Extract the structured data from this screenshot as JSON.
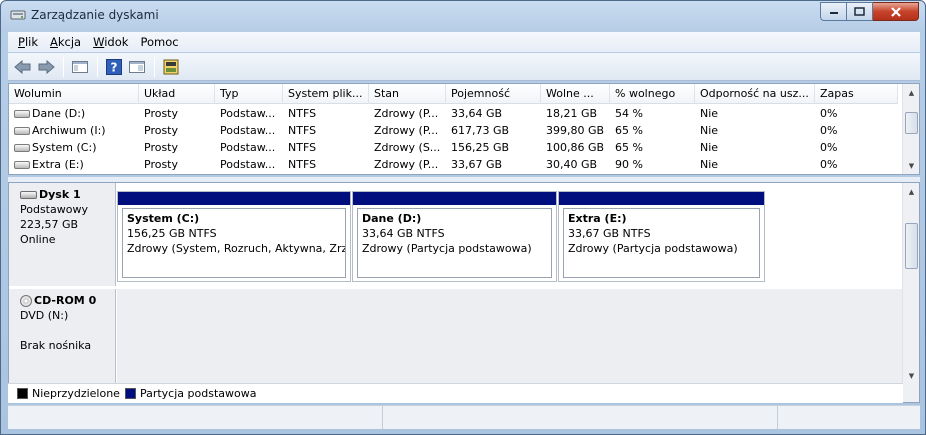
{
  "window": {
    "title": "Zarządzanie dyskami"
  },
  "menu": {
    "items": [
      {
        "label": "Plik",
        "accel": "P",
        "rest": "lik"
      },
      {
        "label": "Akcja",
        "accel": "A",
        "rest": "kcja"
      },
      {
        "label": "Widok",
        "accel": "W",
        "rest": "idok"
      },
      {
        "label": "Pomoc",
        "accel": "",
        "rest": "Pomoc"
      }
    ]
  },
  "toolbar": {
    "icons": [
      "back-icon",
      "forward-icon",
      "console-tree-icon",
      "help-icon",
      "properties-icon",
      "disk-settings-icon"
    ]
  },
  "volume_table": {
    "columns": [
      "Wolumin",
      "Układ",
      "Typ",
      "System plik...",
      "Stan",
      "Pojemność",
      "Wolne ...",
      "% wolnego",
      "Odporność na usz...",
      "Zapas"
    ],
    "rows": [
      [
        "Dane (D:)",
        "Prosty",
        "Podstaw...",
        "NTFS",
        "Zdrowy (P...",
        "33,64 GB",
        "18,21 GB",
        "54 %",
        "Nie",
        "0%"
      ],
      [
        "Archiwum (I:)",
        "Prosty",
        "Podstaw...",
        "NTFS",
        "Zdrowy (P...",
        "617,73 GB",
        "399,80 GB",
        "65 %",
        "Nie",
        "0%"
      ],
      [
        "System (C:)",
        "Prosty",
        "Podstaw...",
        "NTFS",
        "Zdrowy (S...",
        "156,25 GB",
        "100,86 GB",
        "65 %",
        "Nie",
        "0%"
      ],
      [
        "Extra (E:)",
        "Prosty",
        "Podstaw...",
        "NTFS",
        "Zdrowy (P...",
        "33,67 GB",
        "30,40 GB",
        "90 %",
        "Nie",
        "0%"
      ]
    ]
  },
  "disks": {
    "disk1": {
      "name": "Dysk 1",
      "type": "Podstawowy",
      "size": "223,57 GB",
      "status": "Online",
      "partitions": [
        {
          "name": "System  (C:)",
          "size": "156,25 GB NTFS",
          "status": "Zdrowy (System, Rozruch, Aktywna, Zrzut"
        },
        {
          "name": "Dane  (D:)",
          "size": "33,64 GB NTFS",
          "status": "Zdrowy (Partycja podstawowa)"
        },
        {
          "name": "Extra  (E:)",
          "size": "33,67 GB NTFS",
          "status": "Zdrowy (Partycja podstawowa)"
        }
      ]
    },
    "cdrom0": {
      "name": "CD-ROM 0",
      "type": "DVD (N:)",
      "status": "Brak nośnika"
    }
  },
  "legend": {
    "items": [
      {
        "label": "Nieprzydzielone",
        "color": "#000000"
      },
      {
        "label": "Partycja podstawowa",
        "color": "#000e7e"
      }
    ]
  },
  "colors": {
    "primary_partition": "#000e7e",
    "unallocated": "#000000"
  }
}
